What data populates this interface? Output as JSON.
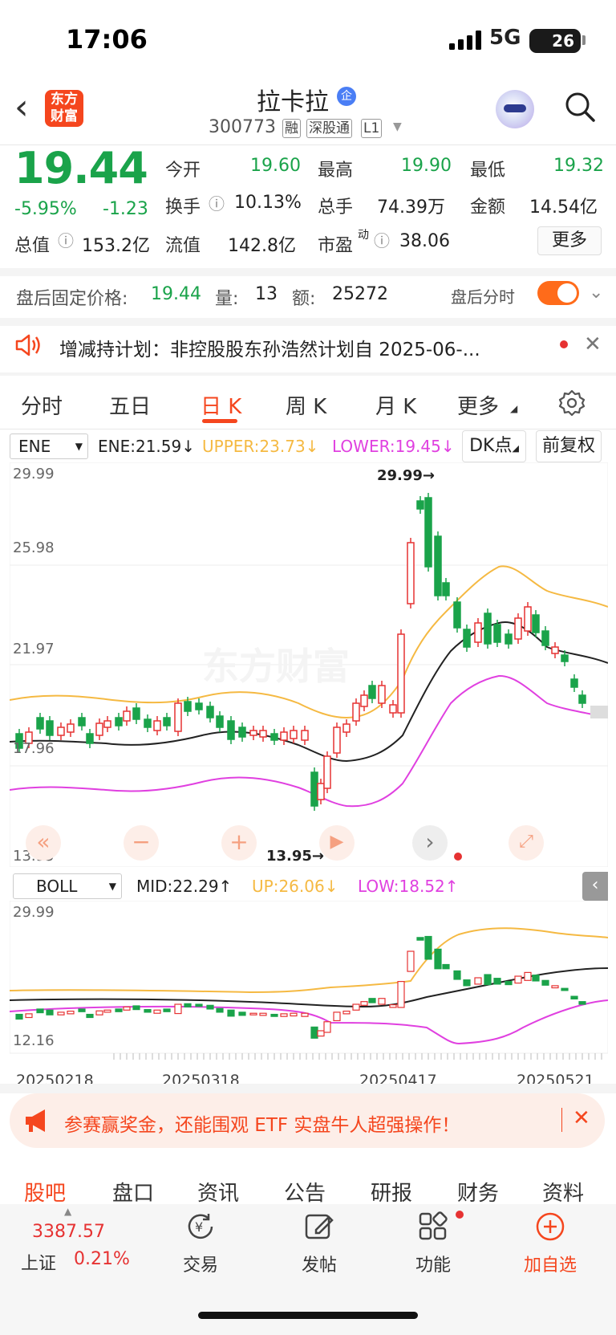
{
  "status": {
    "time": "17:06",
    "network": "5G",
    "battery": "26"
  },
  "header": {
    "logo_line1": "东方",
    "logo_line2": "财富",
    "name": "拉卡拉",
    "qi_badge": "企",
    "code": "300773",
    "tags": [
      "融",
      "深股通",
      "L1"
    ]
  },
  "quote": {
    "price": "19.44",
    "change_pct": "-5.95%",
    "change": "-1.23",
    "open_label": "今开",
    "open": "19.60",
    "high_label": "最高",
    "high": "19.90",
    "low_label": "最低",
    "low": "19.32",
    "turnover_label": "换手",
    "turnover": "10.13%",
    "volume_label": "总手",
    "volume": "74.39万",
    "amount_label": "金额",
    "amount": "14.54亿",
    "mktcap_label": "总值",
    "mktcap": "153.2亿",
    "float_label": "流值",
    "float": "142.8亿",
    "pe_label": "市盈",
    "pe_sup": "动",
    "pe": "38.06",
    "more": "更多"
  },
  "afterhours": {
    "label": "盘后固定价格:",
    "price": "19.44",
    "vol_label": "量:",
    "vol": "13",
    "amt_label": "额:",
    "amt": "25272",
    "toggle_label": "盘后分时"
  },
  "notice": {
    "text": "增减持计划：非控股股东孙浩然计划自 2025-06-..."
  },
  "tabs": [
    "分时",
    "五日",
    "日 K",
    "周 K",
    "月 K",
    "更多"
  ],
  "chart1": {
    "indicator": "ENE",
    "ene": "ENE:21.59↓",
    "upper": "UPPER:23.73↓",
    "lower": "LOWER:19.45↓",
    "dk": "DK点",
    "fq": "前复权",
    "y_labels": [
      "29.99",
      "25.98",
      "21.97",
      "17.96",
      "13.95"
    ],
    "max_mark": "29.99→",
    "min_mark": "13.95→",
    "colors": {
      "up": "#e63232",
      "down": "#1aa34a",
      "upper": "#f5b942",
      "lower": "#e040e0",
      "mid": "#222222"
    }
  },
  "chart2": {
    "indicator": "BOLL",
    "mid": "MID:22.29↑",
    "up": "UP:26.06↓",
    "low": "LOW:18.52↑",
    "y_labels": [
      "29.99",
      "12.16"
    ],
    "dates": [
      "20250218",
      "20250318",
      "20250417",
      "20250521"
    ]
  },
  "banner": {
    "text": "参赛赢奖金，还能围观 ETF 实盘牛人超强操作！"
  },
  "bottom_tabs": [
    "股吧",
    "盘口",
    "资讯",
    "公告",
    "研报",
    "财务",
    "资料"
  ],
  "index": {
    "value": "3387.57",
    "name": "上证",
    "pct": "0.21%"
  },
  "nav": [
    "交易",
    "发帖",
    "功能",
    "加自选"
  ]
}
